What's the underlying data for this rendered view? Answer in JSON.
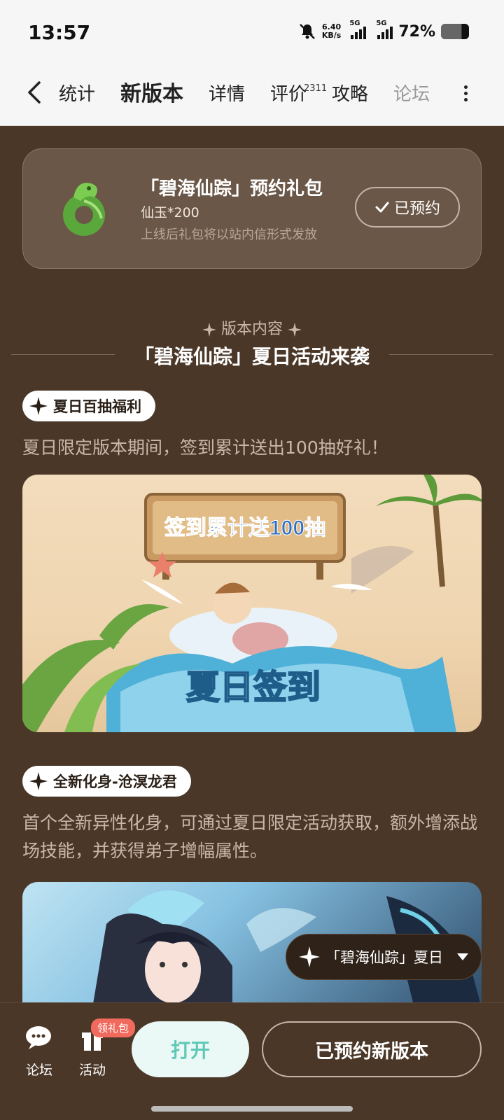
{
  "status_bar": {
    "time": "13:57",
    "speed_value": "6.40",
    "speed_unit": "KB/s",
    "signal1": "5G",
    "signal2": "5G",
    "battery": "72%",
    "battery_level": 0.72
  },
  "nav": {
    "tabs": [
      {
        "label": "统计"
      },
      {
        "label": "新版本",
        "active": true
      },
      {
        "label": "详情"
      },
      {
        "label": "评价",
        "count": "2311"
      },
      {
        "label": "攻略"
      },
      {
        "label": "论坛"
      }
    ]
  },
  "gift": {
    "title": "「碧海仙踪」预约礼包",
    "item": "仙玉*200",
    "note": "上线后礼包将以站内信形式发放",
    "button": "已预约"
  },
  "section": {
    "subtitle": "版本内容",
    "title": "「碧海仙踪」夏日活动来袭"
  },
  "features": [
    {
      "tag": "夏日百抽福利",
      "desc": "夏日限定版本期间，签到累计送出100抽好礼！",
      "banner_title": "签到累计送100抽",
      "banner_caption": "夏日签到"
    },
    {
      "tag": "全新化身-沧溟龙君",
      "desc": "首个全新异性化身，可通过夏日限定活动获取，额外增添战场技能，并获得弟子增幅属性。"
    }
  ],
  "floating_pill": "「碧海仙踪」夏日",
  "bottom": {
    "forum": "论坛",
    "activity": "活动",
    "badge": "领礼包",
    "open": "打开",
    "reserved": "已预约新版本"
  },
  "colors": {
    "accent": "#5fd6c1",
    "background": "#4a3728",
    "badge": "#f06a5d"
  }
}
